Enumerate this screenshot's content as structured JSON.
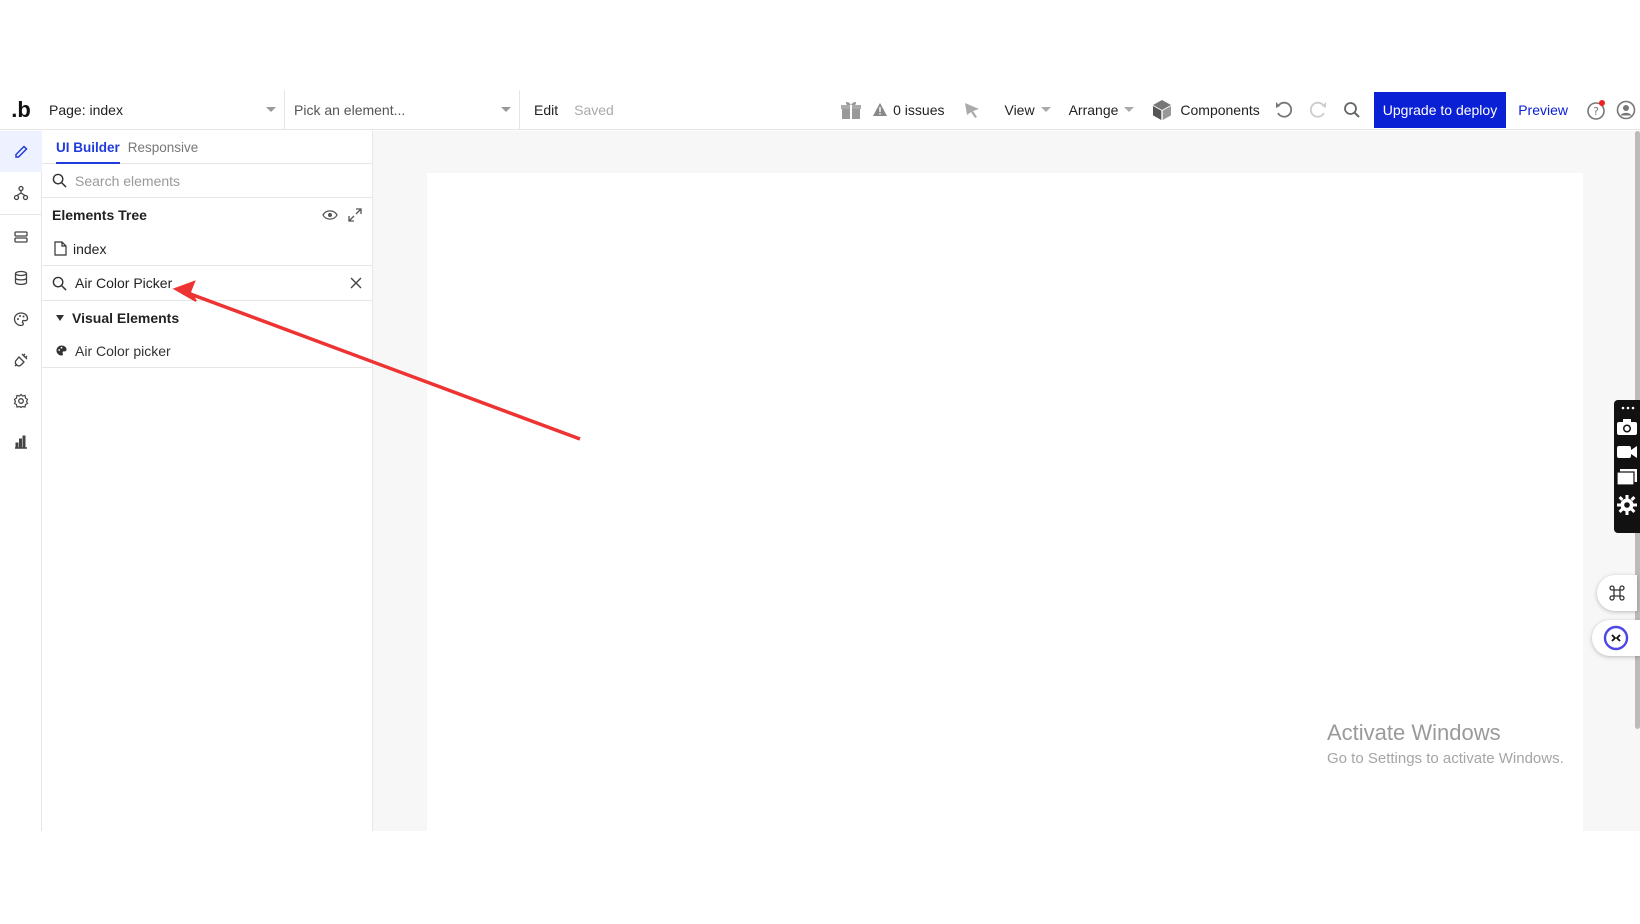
{
  "toolbar": {
    "logo": ".b",
    "page_select": "Page: index",
    "element_select_placeholder": "Pick an element...",
    "edit": "Edit",
    "saved": "Saved",
    "issues": "0 issues",
    "view": "View",
    "arrange": "Arrange",
    "components": "Components",
    "upgrade": "Upgrade to deploy",
    "preview": "Preview"
  },
  "panel": {
    "tabs": [
      "UI Builder",
      "Responsive"
    ],
    "search_placeholder": "Search elements",
    "tree_title": "Elements Tree",
    "page_name": "index",
    "filter_value": "Air Color Picker",
    "group_label": "Visual Elements",
    "items": [
      "Air Color picker"
    ]
  },
  "watermark": {
    "title": "Activate Windows",
    "subtitle": "Go to Settings to activate Windows."
  },
  "colors": {
    "accent": "#0a20d4",
    "tab_active": "#1f3bd9",
    "annotation_arrow": "#ee3333"
  }
}
